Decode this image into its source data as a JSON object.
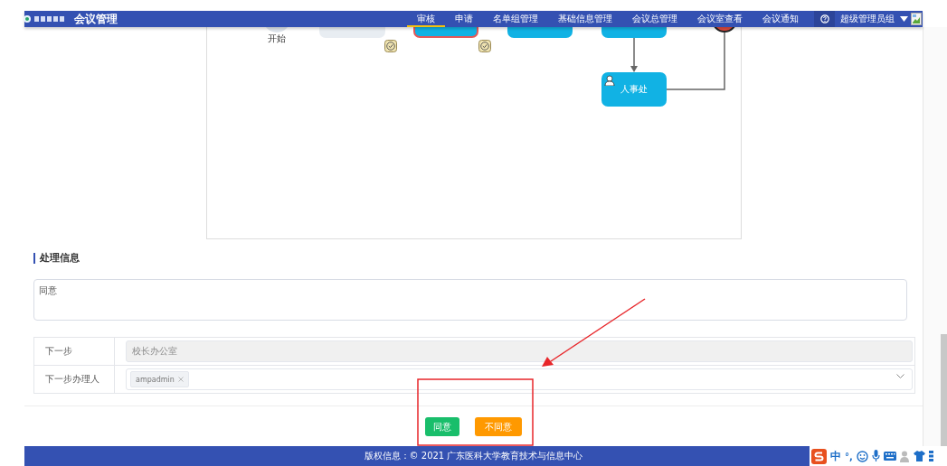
{
  "header": {
    "title": "会议管理",
    "nav": [
      {
        "label": "审核",
        "selected": true
      },
      {
        "label": "申请",
        "selected": false
      },
      {
        "label": "名单组管理",
        "selected": false
      },
      {
        "label": "基础信息管理",
        "selected": false
      },
      {
        "label": "会议总管理",
        "selected": false
      },
      {
        "label": "会议室查看",
        "selected": false
      },
      {
        "label": "会议通知",
        "selected": false
      }
    ],
    "user": "超级管理员组"
  },
  "flow": {
    "nodes": [
      {
        "kind": "start",
        "label": "开始"
      },
      {
        "kind": "task",
        "selected": false
      },
      {
        "kind": "task",
        "selected": true
      },
      {
        "kind": "task",
        "selected": false
      },
      {
        "kind": "task",
        "selected": false
      },
      {
        "kind": "end"
      },
      {
        "kind": "user-task",
        "label": "人事处",
        "selected": false
      }
    ]
  },
  "processing": {
    "heading": "处理信息",
    "opinion": "同意",
    "rows": [
      {
        "kind": "input",
        "label": "下一步",
        "value": "校长办公室",
        "disabled": true
      },
      {
        "kind": "tags",
        "label": "下一步办理人",
        "tags": [
          "ampadmin"
        ]
      }
    ]
  },
  "buttons": [
    {
      "label": "同意",
      "kind": "success"
    },
    {
      "label": "不同意",
      "kind": "warning"
    }
  ],
  "footer": "版权信息：© 2021 广东医科大学教育技术与信息中心",
  "ime": {
    "mode": "中",
    "punct": "°,"
  }
}
